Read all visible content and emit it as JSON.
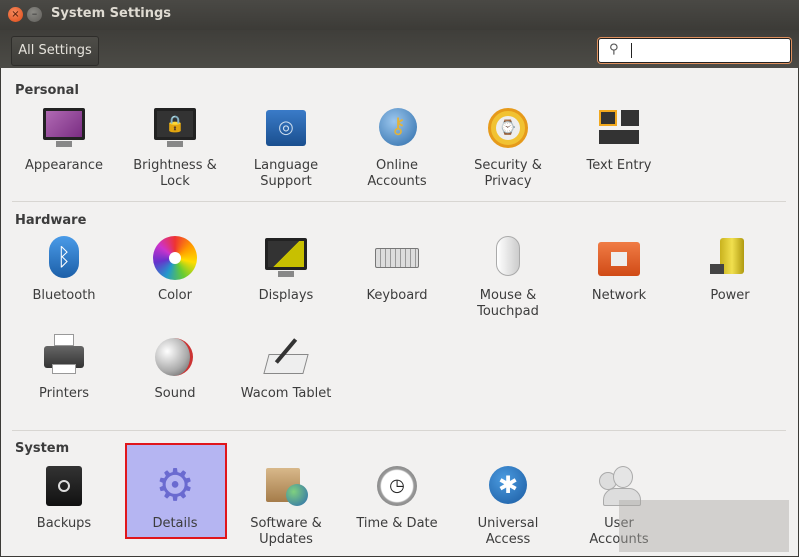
{
  "window": {
    "title": "System Settings",
    "close": "×",
    "minimize": "–"
  },
  "toolbar": {
    "all_settings": "All Settings",
    "search_placeholder": "",
    "search_icon": "⚲"
  },
  "sections": {
    "personal": {
      "title": "Personal",
      "items": [
        "Appearance",
        "Brightness &\nLock",
        "Language\nSupport",
        "Online\nAccounts",
        "Security &\nPrivacy",
        "Text Entry"
      ]
    },
    "hardware": {
      "title": "Hardware",
      "items": [
        "Bluetooth",
        "Color",
        "Displays",
        "Keyboard",
        "Mouse &\nTouchpad",
        "Network",
        "Power",
        "Printers",
        "Sound",
        "Wacom Tablet"
      ]
    },
    "system": {
      "title": "System",
      "items": [
        "Backups",
        "Details",
        "Software &\nUpdates",
        "Time & Date",
        "Universal\nAccess",
        "User\nAccounts"
      ]
    }
  },
  "selected": "Details",
  "colors": {
    "highlight_fill": "#b5b5f2",
    "highlight_border": "#e0161c",
    "accent": "#e0915e"
  }
}
